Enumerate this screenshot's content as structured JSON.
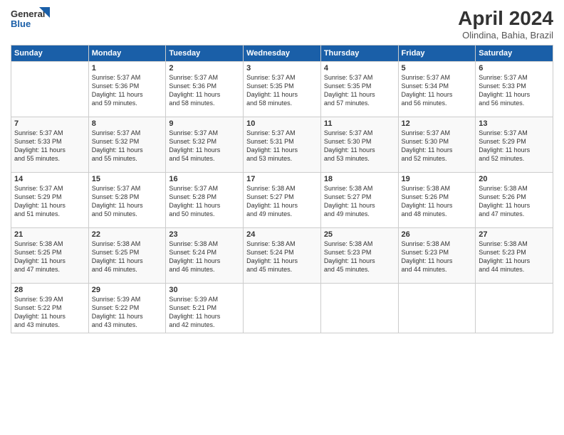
{
  "header": {
    "logo_line1": "General",
    "logo_line2": "Blue",
    "title": "April 2024",
    "subtitle": "Olindina, Bahia, Brazil"
  },
  "columns": [
    "Sunday",
    "Monday",
    "Tuesday",
    "Wednesday",
    "Thursday",
    "Friday",
    "Saturday"
  ],
  "weeks": [
    [
      {
        "day": "",
        "detail": ""
      },
      {
        "day": "1",
        "detail": "Sunrise: 5:37 AM\nSunset: 5:36 PM\nDaylight: 11 hours\nand 59 minutes."
      },
      {
        "day": "2",
        "detail": "Sunrise: 5:37 AM\nSunset: 5:36 PM\nDaylight: 11 hours\nand 58 minutes."
      },
      {
        "day": "3",
        "detail": "Sunrise: 5:37 AM\nSunset: 5:35 PM\nDaylight: 11 hours\nand 58 minutes."
      },
      {
        "day": "4",
        "detail": "Sunrise: 5:37 AM\nSunset: 5:35 PM\nDaylight: 11 hours\nand 57 minutes."
      },
      {
        "day": "5",
        "detail": "Sunrise: 5:37 AM\nSunset: 5:34 PM\nDaylight: 11 hours\nand 56 minutes."
      },
      {
        "day": "6",
        "detail": "Sunrise: 5:37 AM\nSunset: 5:33 PM\nDaylight: 11 hours\nand 56 minutes."
      }
    ],
    [
      {
        "day": "7",
        "detail": "Sunrise: 5:37 AM\nSunset: 5:33 PM\nDaylight: 11 hours\nand 55 minutes."
      },
      {
        "day": "8",
        "detail": "Sunrise: 5:37 AM\nSunset: 5:32 PM\nDaylight: 11 hours\nand 55 minutes."
      },
      {
        "day": "9",
        "detail": "Sunrise: 5:37 AM\nSunset: 5:32 PM\nDaylight: 11 hours\nand 54 minutes."
      },
      {
        "day": "10",
        "detail": "Sunrise: 5:37 AM\nSunset: 5:31 PM\nDaylight: 11 hours\nand 53 minutes."
      },
      {
        "day": "11",
        "detail": "Sunrise: 5:37 AM\nSunset: 5:30 PM\nDaylight: 11 hours\nand 53 minutes."
      },
      {
        "day": "12",
        "detail": "Sunrise: 5:37 AM\nSunset: 5:30 PM\nDaylight: 11 hours\nand 52 minutes."
      },
      {
        "day": "13",
        "detail": "Sunrise: 5:37 AM\nSunset: 5:29 PM\nDaylight: 11 hours\nand 52 minutes."
      }
    ],
    [
      {
        "day": "14",
        "detail": "Sunrise: 5:37 AM\nSunset: 5:29 PM\nDaylight: 11 hours\nand 51 minutes."
      },
      {
        "day": "15",
        "detail": "Sunrise: 5:37 AM\nSunset: 5:28 PM\nDaylight: 11 hours\nand 50 minutes."
      },
      {
        "day": "16",
        "detail": "Sunrise: 5:37 AM\nSunset: 5:28 PM\nDaylight: 11 hours\nand 50 minutes."
      },
      {
        "day": "17",
        "detail": "Sunrise: 5:38 AM\nSunset: 5:27 PM\nDaylight: 11 hours\nand 49 minutes."
      },
      {
        "day": "18",
        "detail": "Sunrise: 5:38 AM\nSunset: 5:27 PM\nDaylight: 11 hours\nand 49 minutes."
      },
      {
        "day": "19",
        "detail": "Sunrise: 5:38 AM\nSunset: 5:26 PM\nDaylight: 11 hours\nand 48 minutes."
      },
      {
        "day": "20",
        "detail": "Sunrise: 5:38 AM\nSunset: 5:26 PM\nDaylight: 11 hours\nand 47 minutes."
      }
    ],
    [
      {
        "day": "21",
        "detail": "Sunrise: 5:38 AM\nSunset: 5:25 PM\nDaylight: 11 hours\nand 47 minutes."
      },
      {
        "day": "22",
        "detail": "Sunrise: 5:38 AM\nSunset: 5:25 PM\nDaylight: 11 hours\nand 46 minutes."
      },
      {
        "day": "23",
        "detail": "Sunrise: 5:38 AM\nSunset: 5:24 PM\nDaylight: 11 hours\nand 46 minutes."
      },
      {
        "day": "24",
        "detail": "Sunrise: 5:38 AM\nSunset: 5:24 PM\nDaylight: 11 hours\nand 45 minutes."
      },
      {
        "day": "25",
        "detail": "Sunrise: 5:38 AM\nSunset: 5:23 PM\nDaylight: 11 hours\nand 45 minutes."
      },
      {
        "day": "26",
        "detail": "Sunrise: 5:38 AM\nSunset: 5:23 PM\nDaylight: 11 hours\nand 44 minutes."
      },
      {
        "day": "27",
        "detail": "Sunrise: 5:38 AM\nSunset: 5:23 PM\nDaylight: 11 hours\nand 44 minutes."
      }
    ],
    [
      {
        "day": "28",
        "detail": "Sunrise: 5:39 AM\nSunset: 5:22 PM\nDaylight: 11 hours\nand 43 minutes."
      },
      {
        "day": "29",
        "detail": "Sunrise: 5:39 AM\nSunset: 5:22 PM\nDaylight: 11 hours\nand 43 minutes."
      },
      {
        "day": "30",
        "detail": "Sunrise: 5:39 AM\nSunset: 5:21 PM\nDaylight: 11 hours\nand 42 minutes."
      },
      {
        "day": "",
        "detail": ""
      },
      {
        "day": "",
        "detail": ""
      },
      {
        "day": "",
        "detail": ""
      },
      {
        "day": "",
        "detail": ""
      }
    ]
  ]
}
